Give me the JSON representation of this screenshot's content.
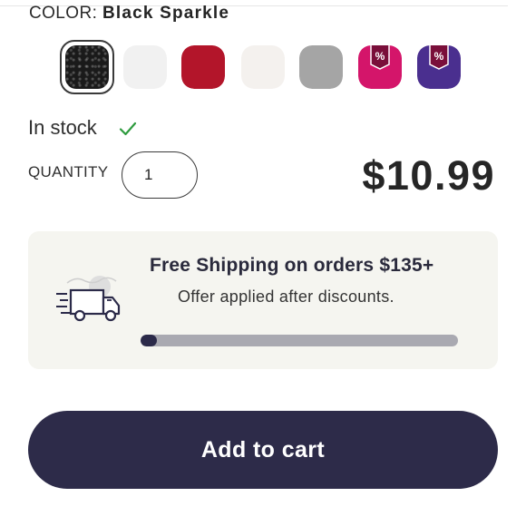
{
  "color": {
    "label": "COLOR:",
    "selected": "Black Sparkle",
    "swatches": [
      {
        "name": "Black Sparkle",
        "color": "#1a1a1a",
        "selected": true,
        "sale": false
      },
      {
        "name": "White",
        "color": "#f1f1f1",
        "selected": false,
        "sale": false
      },
      {
        "name": "Red",
        "color": "#b3152a",
        "selected": false,
        "sale": false
      },
      {
        "name": "Off White",
        "color": "#f4f1ee",
        "selected": false,
        "sale": false
      },
      {
        "name": "Gray",
        "color": "#a5a5a5",
        "selected": false,
        "sale": false
      },
      {
        "name": "Pink",
        "color": "#d4156a",
        "selected": false,
        "sale": true
      },
      {
        "name": "Purple",
        "color": "#4a2f8f",
        "selected": false,
        "sale": true
      }
    ],
    "sale_badge": "%"
  },
  "stock": {
    "label": "In stock",
    "icon": "checkmark-icon",
    "color": "#2e9b3e"
  },
  "quantity": {
    "label": "QUANTITY",
    "value": "1"
  },
  "price": "$10.99",
  "shipping": {
    "title": "Free Shipping on orders $135+",
    "subtitle": "Offer applied after discounts.",
    "progress": 0.05,
    "icon": "delivery-truck-icon"
  },
  "cart_button": {
    "label": "Add to cart"
  },
  "colors": {
    "brand": "#2d2b49",
    "card": "#f5f5f0",
    "track": "#a9a9b1"
  }
}
